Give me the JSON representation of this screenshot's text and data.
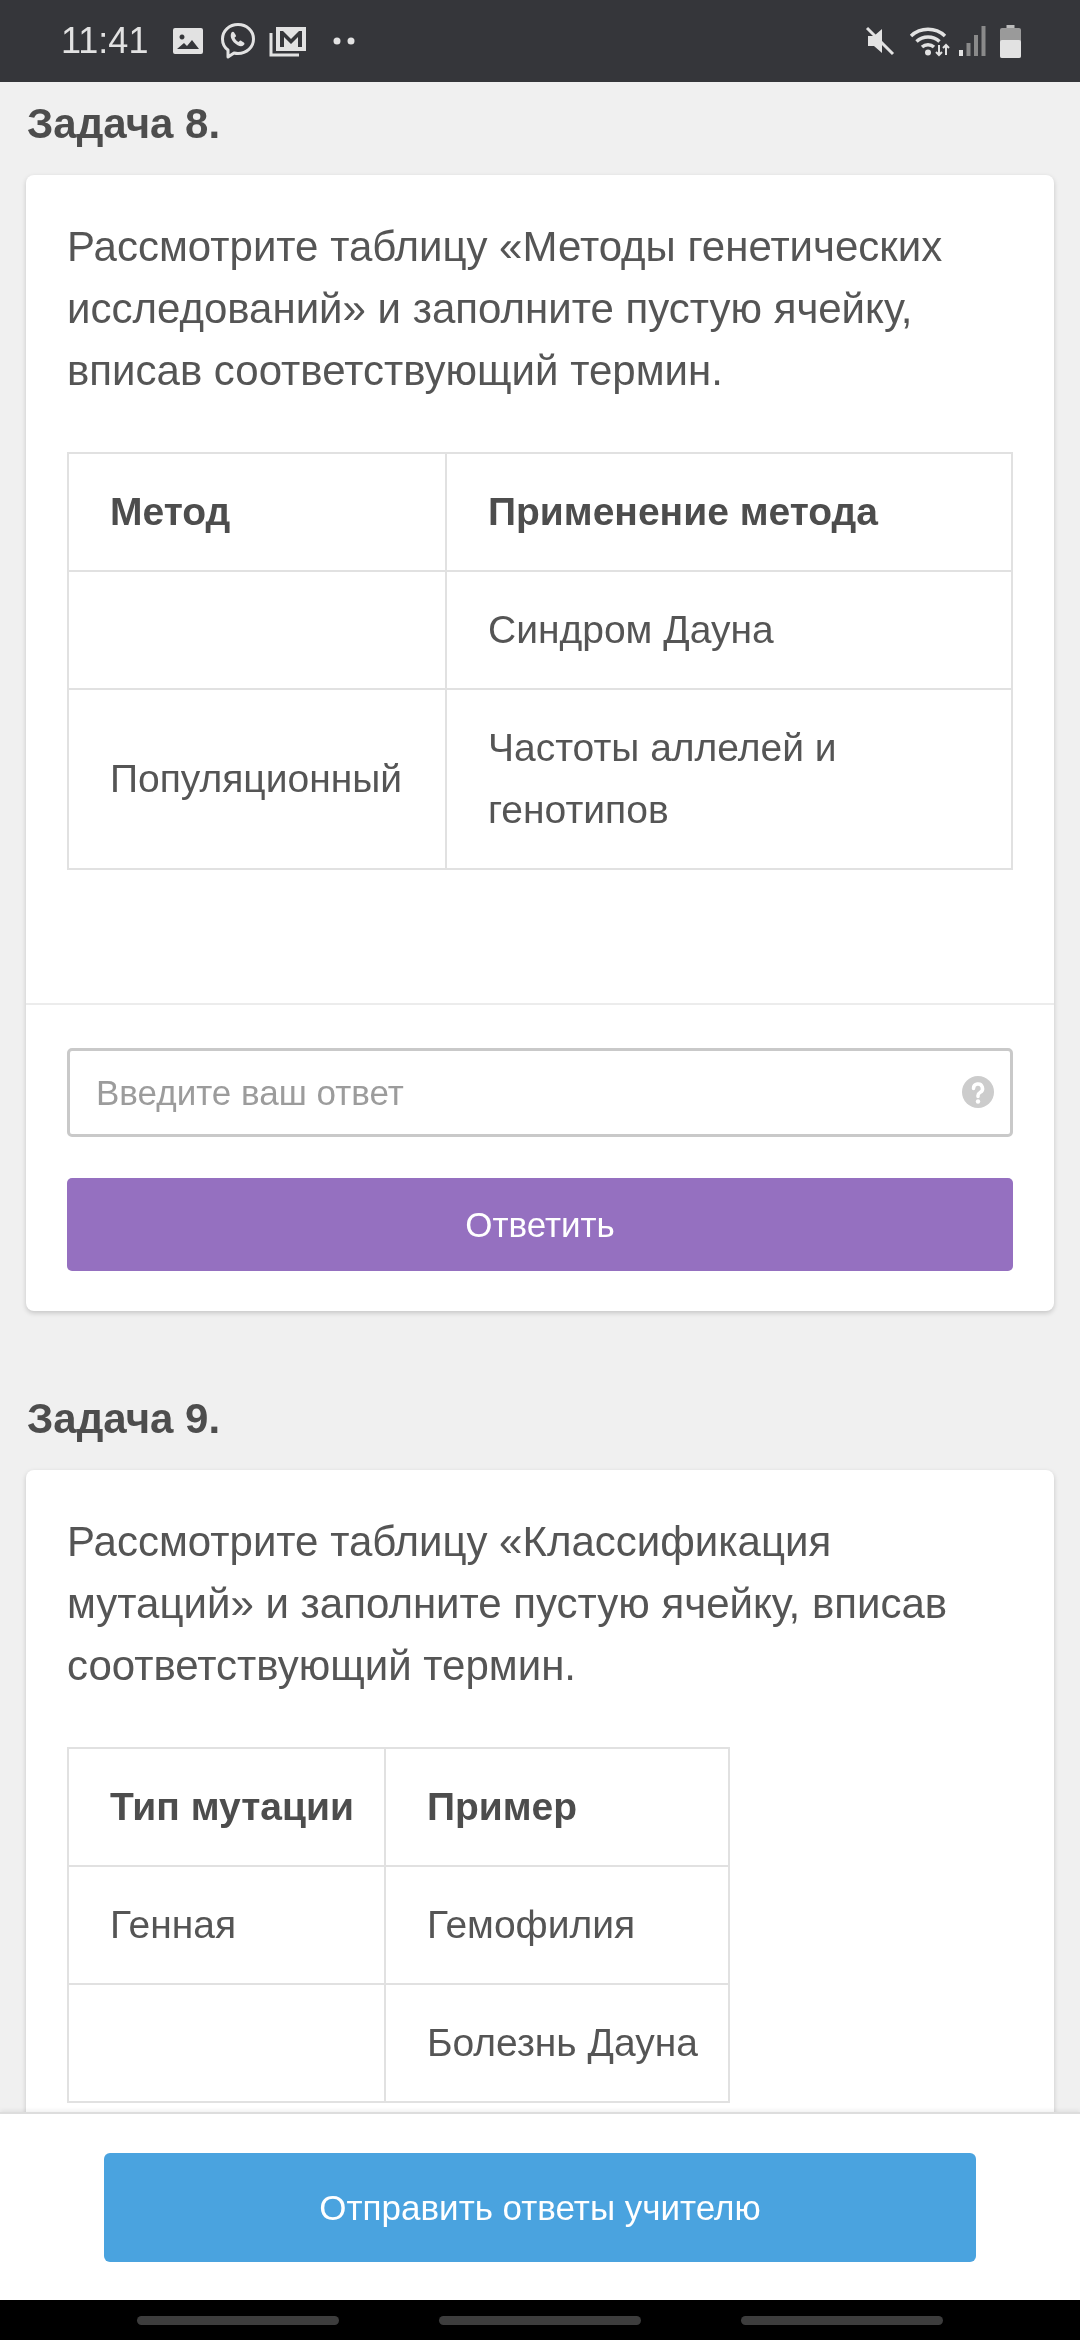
{
  "status_bar": {
    "time": "11:41"
  },
  "tasks": [
    {
      "title": "Задача 8.",
      "prompt": "Рассмотрите таблицу «Методы генетических исследований» и заполните пустую ячейку, вписав соответствующий термин.",
      "table": {
        "columns": [
          "Метод",
          "Применение метода"
        ],
        "rows": [
          [
            {
              "kind": "blank"
            },
            {
              "kind": "text",
              "text": "Синдром Дауна"
            }
          ],
          [
            {
              "kind": "text",
              "text": "Популяционный"
            },
            {
              "kind": "text",
              "text": "Частоты аллелей и генотипов"
            }
          ]
        ]
      },
      "answer": {
        "placeholder": "Введите ваш ответ",
        "button": "Ответить"
      }
    },
    {
      "title": "Задача 9.",
      "prompt": "Рассмотрите таблицу «Классификация мутаций» и заполните пустую ячейку, вписав соответствующий термин.",
      "table": {
        "columns": [
          "Тип мутации",
          "Пример"
        ],
        "rows": [
          [
            {
              "kind": "text",
              "text": "Генная"
            },
            {
              "kind": "text",
              "text": "Гемофилия"
            }
          ],
          [
            {
              "kind": "blank"
            },
            {
              "kind": "text",
              "text": "Болезнь Дауна"
            }
          ]
        ]
      }
    }
  ],
  "submit_button": "Отправить ответы учителю"
}
